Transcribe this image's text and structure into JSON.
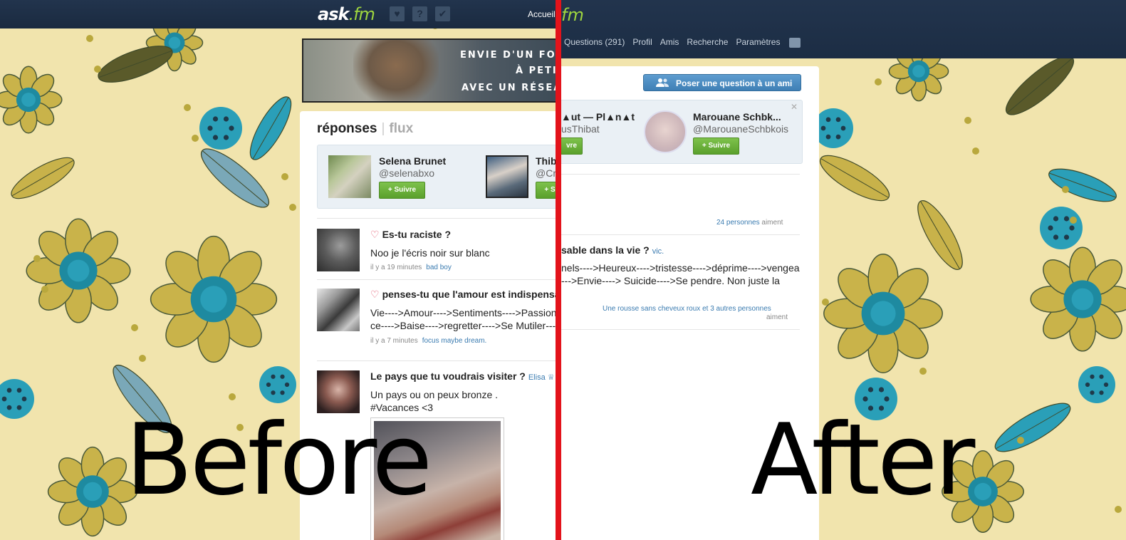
{
  "before": {
    "logo": {
      "ask": "ask",
      "fm": ".fm"
    },
    "nav_icons": [
      "heart-icon",
      "question-icon",
      "check-icon"
    ],
    "nav_home": "Accueil",
    "banner_lines": [
      "ENVIE D'UN FO",
      "À PETI",
      "AVEC UN RÉSEAU"
    ],
    "tabs": {
      "active": "réponses",
      "inactive": "flux"
    },
    "suggestions": [
      {
        "name": "Selena Brunet",
        "handle": "@selenabxo",
        "follow": "+ Suivre"
      },
      {
        "name": "Thib",
        "handle": "@Cr",
        "follow": "+ S"
      }
    ],
    "questions": [
      {
        "question": "Es-tu raciste ?",
        "asker": "",
        "answer_lines": [
          "Noo je l'écris noir sur blanc"
        ],
        "time": "il y a 19 minutes",
        "answerer": "bad boy",
        "liked": true
      },
      {
        "question": "penses-tu que l'amour est indispensa",
        "asker": "",
        "answer_lines": [
          "Vie---->Amour---->Sentiments---->Passion",
          "ce---->Baise---->regretter---->Se Mutiler----"
        ],
        "time": "il y a 7 minutes",
        "answerer": "focus maybe dream.",
        "liked": true
      },
      {
        "question": "Le pays que tu voudrais visiter ?",
        "asker": "Elisa ♕",
        "answer_lines": [
          "Un pays ou on peux bronze .",
          "#Vacances <3"
        ],
        "time": "",
        "answerer": "",
        "liked": false
      }
    ],
    "label": "Before"
  },
  "after": {
    "logo_fm": "fm",
    "nav": [
      "Questions (291)",
      "Profil",
      "Amis",
      "Recherche",
      "Paramètres"
    ],
    "ask_friend_button": "Poser une question à un ami",
    "suggestions": [
      {
        "name": "▲ut — Pl▲n▲t",
        "handle": "usThibat",
        "follow": "vre"
      },
      {
        "name": "Marouane Schbk...",
        "handle": "@MarouaneSchbkois",
        "follow": "+ Suivre"
      }
    ],
    "likes_1": {
      "who": "24 personnes",
      "verb": "aiment"
    },
    "question": {
      "text": "sable dans la vie ?",
      "asker": "vic."
    },
    "answer_lines": [
      "nels---->Heureux---->tristesse---->déprime---->vengea",
      "--->Envie----> Suicide---->Se pendre. Non juste la"
    ],
    "likes_2": {
      "who": "Une rousse sans cheveux roux et 3 autres personnes",
      "verb": "aiment"
    },
    "label": "After"
  },
  "colors": {
    "topbar": "#1f3047",
    "divider_line": "#e3131b",
    "follow_green": "#62a833",
    "ask_blue": "#4a89be",
    "link_blue": "#3a7bb0",
    "heart_pink": "#e3546b"
  }
}
